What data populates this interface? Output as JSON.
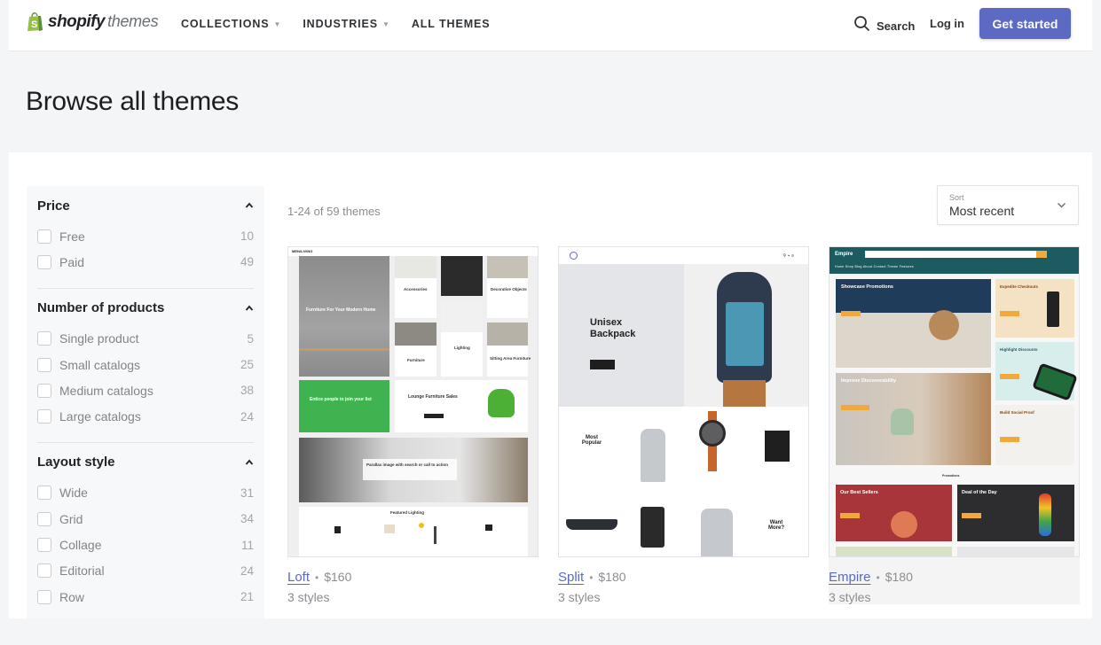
{
  "header": {
    "logo_bold": "shopify",
    "logo_light": "themes",
    "logo_icon": "shopping-bag-icon",
    "nav": [
      {
        "label": "COLLECTIONS",
        "has_dropdown": true
      },
      {
        "label": "INDUSTRIES",
        "has_dropdown": true
      },
      {
        "label": "ALL THEMES",
        "has_dropdown": false
      }
    ],
    "search_label": "Search",
    "login_label": "Log in",
    "cta_label": "Get started",
    "cta_color": "#5c6ac4"
  },
  "page": {
    "title": "Browse all themes"
  },
  "filters": [
    {
      "title": "Price",
      "expanded": true,
      "options": [
        {
          "label": "Free",
          "count": "10",
          "checked": false
        },
        {
          "label": "Paid",
          "count": "49",
          "checked": false
        }
      ]
    },
    {
      "title": "Number of products",
      "expanded": true,
      "options": [
        {
          "label": "Single product",
          "count": "5",
          "checked": false
        },
        {
          "label": "Small catalogs",
          "count": "25",
          "checked": false
        },
        {
          "label": "Medium catalogs",
          "count": "38",
          "checked": false
        },
        {
          "label": "Large catalogs",
          "count": "24",
          "checked": false
        }
      ]
    },
    {
      "title": "Layout style",
      "expanded": true,
      "options": [
        {
          "label": "Wide",
          "count": "31",
          "checked": false
        },
        {
          "label": "Grid",
          "count": "34",
          "checked": false
        },
        {
          "label": "Collage",
          "count": "11",
          "checked": false
        },
        {
          "label": "Editorial",
          "count": "24",
          "checked": false
        },
        {
          "label": "Row",
          "count": "21",
          "checked": false
        }
      ]
    }
  ],
  "results": {
    "count_text": "1-24 of 59 themes",
    "sort_label": "Sort",
    "sort_value": "Most recent"
  },
  "themes": [
    {
      "name": "Loft",
      "price": "$160",
      "styles": "3 styles",
      "preview": {
        "brand": "MEN/LIVING",
        "hero": "Furniture For Your Modern Home",
        "tiles": [
          "Accessories",
          "Decorative Objects",
          "Furniture",
          "Lighting",
          "Sitting Area Furniture"
        ],
        "promo": "Entice people to join your list",
        "sale": "Lounge Furniture Sales",
        "parallax": "Parallax image with search or call to action",
        "featured": "Featured Lighting"
      }
    },
    {
      "name": "Split",
      "price": "$180",
      "styles": "3 styles",
      "preview": {
        "hero": "Unisex Backpack",
        "section": "Most Popular",
        "more": "Want More?"
      }
    },
    {
      "name": "Empire",
      "price": "$180",
      "styles": "3 styles",
      "preview": {
        "brand": "Empire",
        "nav": "Home   Shop   Blog   About   Contact   Theme Features",
        "blocks": [
          "Showcase Promotions",
          "Expedite Checkouts",
          "Highlight Discounts",
          "Improve Discoverability",
          "Build Social Proof",
          "Our Best Sellers",
          "Deal of the Day"
        ],
        "section": "Promotions"
      }
    }
  ]
}
